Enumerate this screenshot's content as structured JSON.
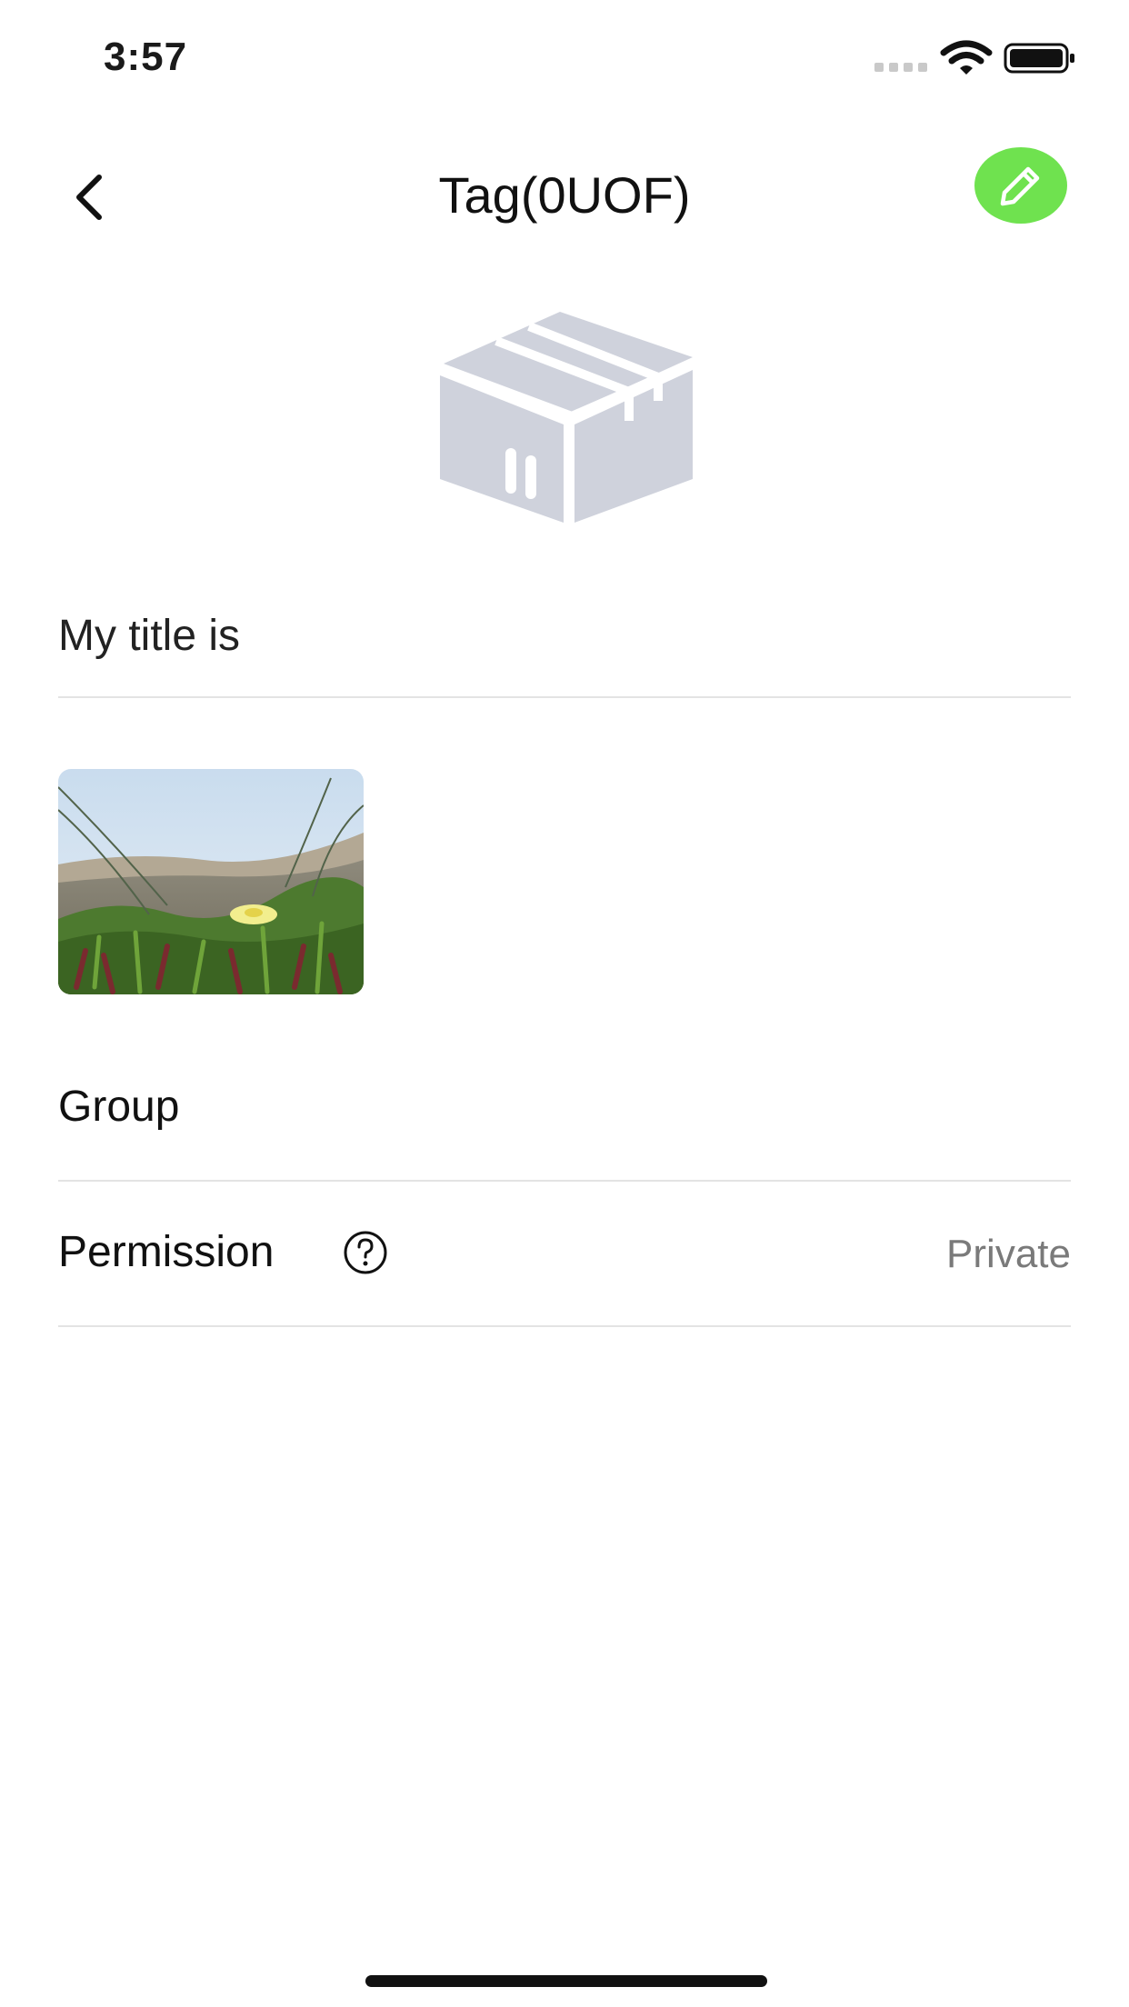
{
  "status_bar": {
    "time": "3:57"
  },
  "nav": {
    "title": "Tag(0UOF)"
  },
  "item": {
    "title_placeholder": "My title is",
    "group_label": "Group",
    "permission_label": "Permission",
    "permission_value": "Private"
  },
  "icons": {
    "back": "chevron-left-icon",
    "edit": "pencil-icon",
    "help": "question-circle-icon",
    "placeholder": "package-box-icon"
  },
  "colors": {
    "accent": "#6fe24f",
    "divider": "#e3e3e3",
    "secondary_text": "#7a7a7a",
    "box_gray": "#cfd2dc"
  }
}
